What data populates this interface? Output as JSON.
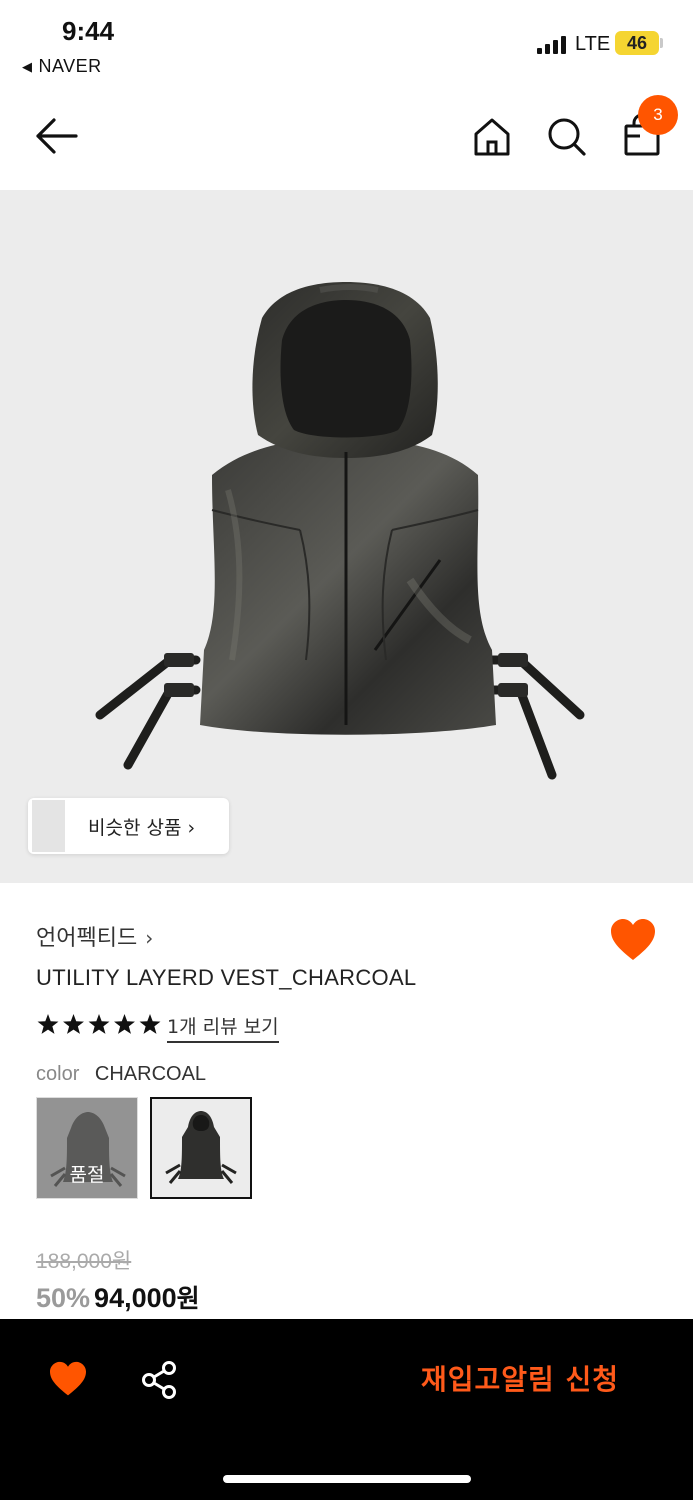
{
  "status_bar": {
    "time": "9:44",
    "back_app": "NAVER",
    "network": "LTE",
    "battery": "46"
  },
  "nav": {
    "cart_count": "3",
    "icons": [
      "arrow-left-icon",
      "home-icon",
      "search-icon",
      "shopping-bag-icon"
    ]
  },
  "hero": {
    "similar_products_label": "비슷한 상품"
  },
  "product": {
    "brand": "언어펙티드",
    "name": "UTILITY LAYERD VEST_CHARCOAL",
    "rating": 5,
    "review_link": "1개 리뷰 보기",
    "color_label": "color",
    "color_value": "CHARCOAL",
    "swatches": [
      {
        "sold_out_label": "품절"
      },
      {
        "selected": true
      }
    ],
    "original_price": "188,000원",
    "discount": "50%",
    "sale_price_number": "94,000",
    "sale_price_unit": "원",
    "wishlisted": true
  },
  "bottom_bar": {
    "restock_label": "재입고알림 신청",
    "icons": [
      "heart-icon",
      "share-icon"
    ]
  },
  "colors": {
    "accent": "#ff5500",
    "restock_text": "#ff5a1a",
    "battery": "#f5d531",
    "bottom_bar": "#000000"
  }
}
